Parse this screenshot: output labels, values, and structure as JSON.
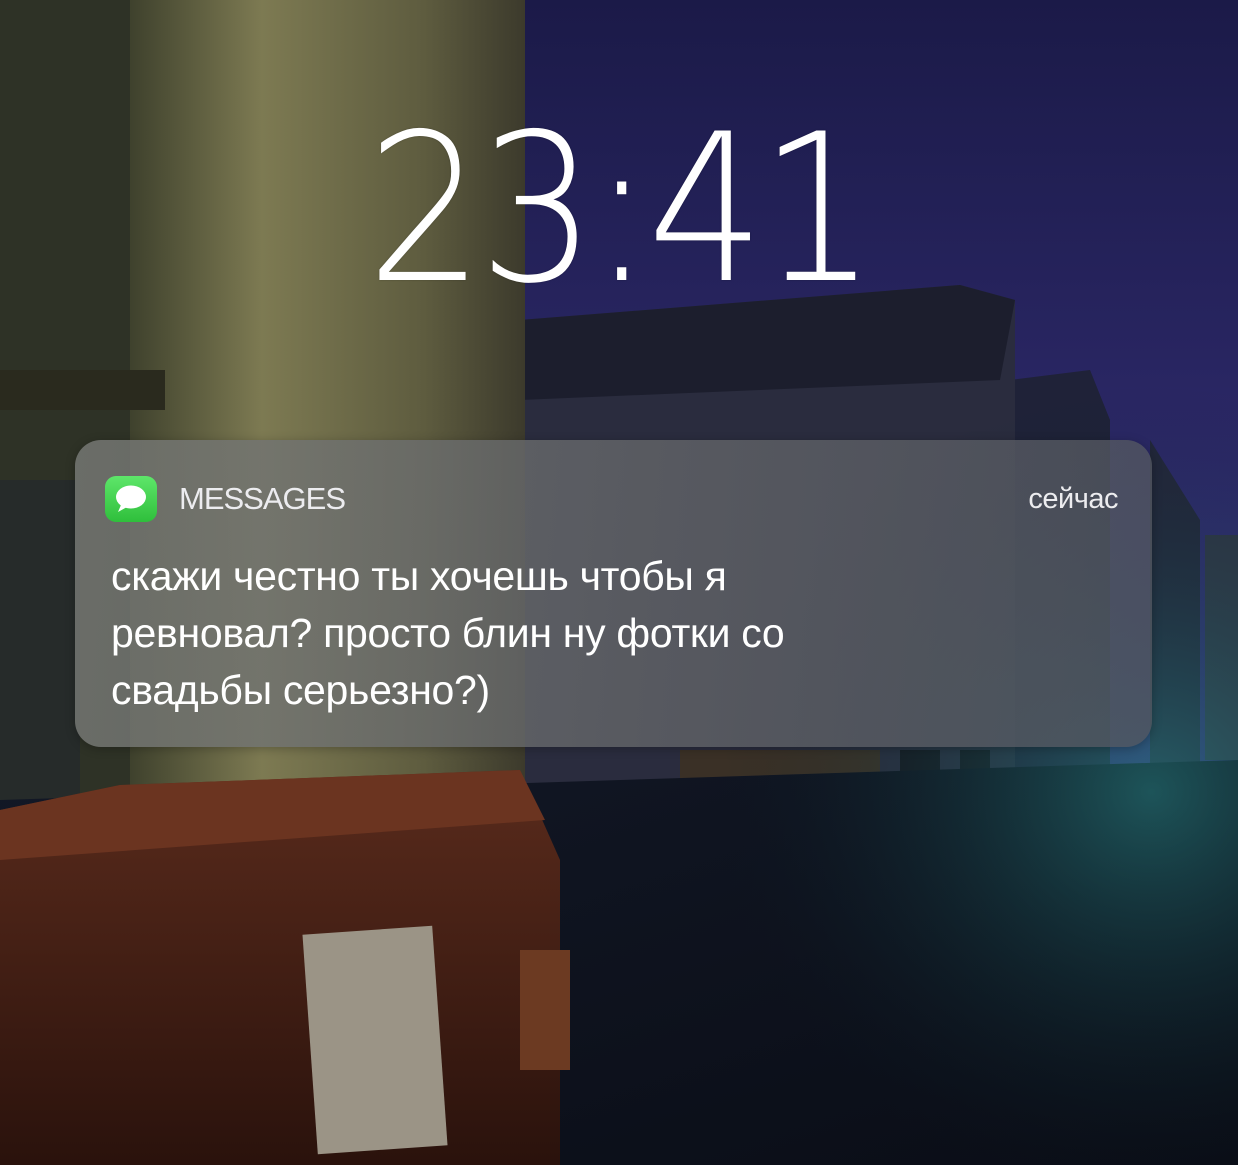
{
  "lockscreen": {
    "time": "23:41"
  },
  "notification": {
    "app_name": "MESSAGES",
    "app_icon": "messages-bubble-icon",
    "timestamp": "сейчас",
    "message_lines": [
      "скажи честно ты хочешь чтобы я",
      "ревновал? просто блин ну фотки со",
      "свадьбы серьезно?)"
    ]
  },
  "colors": {
    "app_icon_green": "#34c759",
    "text_white": "#ffffff",
    "sky_purple": "#2c2868"
  }
}
